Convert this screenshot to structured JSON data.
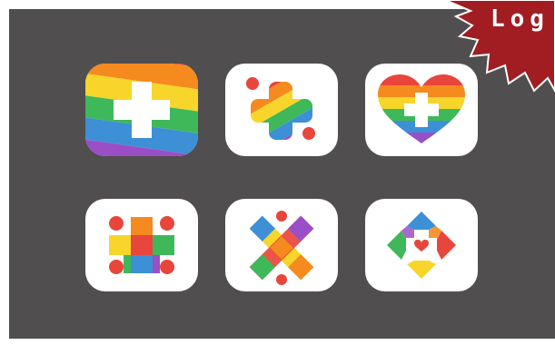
{
  "badge": {
    "text": "Log"
  },
  "icons": [
    {
      "name": "rainbow-square-cross-icon"
    },
    {
      "name": "rainbow-plus-dots-icon"
    },
    {
      "name": "rainbow-heart-cross-icon"
    },
    {
      "name": "color-block-cross-dots-icon"
    },
    {
      "name": "rainbow-x-bandage-icon"
    },
    {
      "name": "flower-heart-cross-icon"
    }
  ],
  "colors": {
    "background": "#504e4e",
    "badge": "#a11d22",
    "red": "#e8453c",
    "orange": "#f58a1f",
    "yellow": "#f8d52a",
    "green": "#3fb85a",
    "blue": "#3d8fd6",
    "purple": "#9a4fc6"
  }
}
